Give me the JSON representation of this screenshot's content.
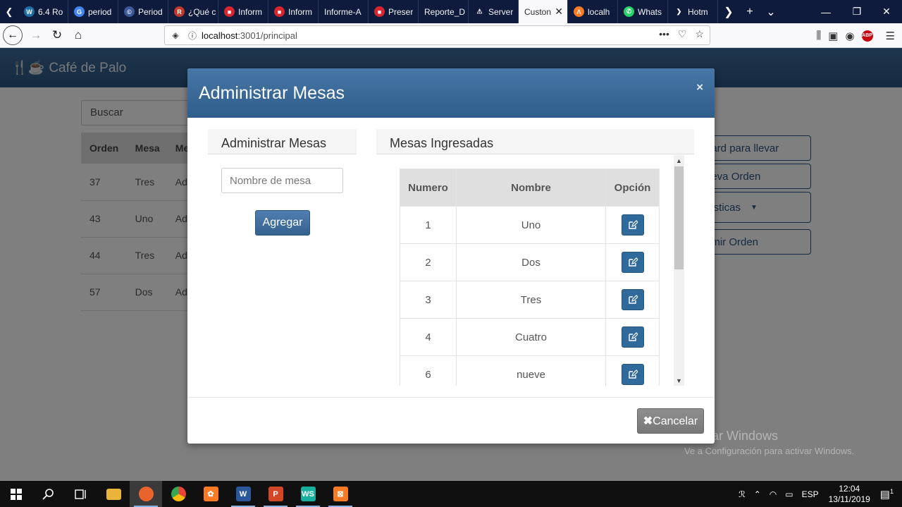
{
  "browser": {
    "tabs": [
      {
        "label": "6.4 Ro",
        "icon": "wordpress-icon",
        "color": "#1e6fa6",
        "glyph": "W"
      },
      {
        "label": "period",
        "icon": "google-icon",
        "color": "#4285f4",
        "glyph": "G"
      },
      {
        "label": "Period",
        "icon": "tab-icon",
        "color": "#3b5998",
        "glyph": "©"
      },
      {
        "label": "¿Qué c",
        "icon": "r-icon",
        "color": "#c0392b",
        "glyph": "R"
      },
      {
        "label": "Inform",
        "icon": "pdf-icon",
        "color": "#d7262e",
        "glyph": "■"
      },
      {
        "label": "Inform",
        "icon": "pdf-icon",
        "color": "#d7262e",
        "glyph": "■"
      },
      {
        "label": "Informe-A",
        "icon": "none",
        "color": "",
        "glyph": ""
      },
      {
        "label": "Preser",
        "icon": "pdf-icon",
        "color": "#d7262e",
        "glyph": "■"
      },
      {
        "label": "Reporte_D",
        "icon": "none",
        "color": "",
        "glyph": ""
      },
      {
        "label": "Server",
        "icon": "warning-icon",
        "color": "#0f1b3d",
        "glyph": "⚠"
      },
      {
        "label": "Custon",
        "icon": "none",
        "color": "",
        "glyph": "",
        "active": true
      },
      {
        "label": "localh",
        "icon": "xampp-icon",
        "color": "#fb7a24",
        "glyph": "Λ"
      },
      {
        "label": "Whats",
        "icon": "whatsapp-icon",
        "color": "#25d366",
        "glyph": "✆"
      },
      {
        "label": "Hotm",
        "icon": "hotmart-icon",
        "color": "#0f1b3d",
        "glyph": "❯"
      }
    ],
    "url_host": "localhost",
    "url_path": ":3001/principal"
  },
  "app": {
    "brand": "Café de Palo",
    "search_placeholder": "Buscar",
    "orders_table": {
      "headers": [
        "Orden",
        "Mesa",
        "Me"
      ],
      "rows": [
        [
          "37",
          "Tres",
          "Ad"
        ],
        [
          "43",
          "Uno",
          "Ad"
        ],
        [
          "44",
          "Tres",
          "Ad"
        ],
        [
          "57",
          "Dos",
          "Ad"
        ]
      ]
    },
    "side_buttons": [
      "oard para llevar",
      "ueva Orden",
      "disticas",
      "rimir Orden"
    ]
  },
  "modal": {
    "title": "Administrar Mesas",
    "close_label": "×",
    "left_panel_title": "Administrar Mesas",
    "name_input_placeholder": "Nombre de mesa",
    "add_button": "Agregar",
    "right_panel_title": "Mesas Ingresadas",
    "table": {
      "headers": [
        "Numero",
        "Nombre",
        "Opción"
      ],
      "rows": [
        {
          "numero": "1",
          "nombre": "Uno"
        },
        {
          "numero": "2",
          "nombre": "Dos"
        },
        {
          "numero": "3",
          "nombre": "Tres"
        },
        {
          "numero": "4",
          "nombre": "Cuatro"
        },
        {
          "numero": "6",
          "nombre": "nueve"
        }
      ]
    },
    "cancel_button": "Cancelar"
  },
  "watermark": {
    "line1": "Activar Windows",
    "line2": "Ve a Configuración para activar Windows."
  },
  "taskbar": {
    "language": "ESP",
    "time": "12:04",
    "date": "13/11/2019",
    "notification_count": "1"
  }
}
